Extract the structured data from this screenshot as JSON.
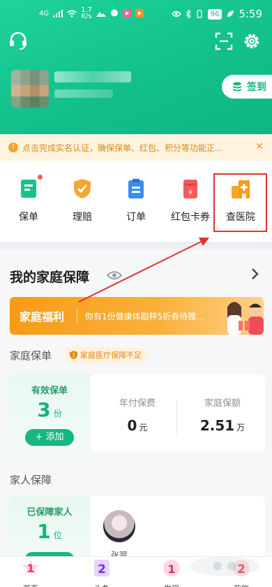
{
  "status_bar": {
    "signal": "4G",
    "speed_value": "1.7",
    "speed_unit": "K/s",
    "battery": "96",
    "time": "5:59"
  },
  "header": {
    "checkin_label": "签到"
  },
  "notice": {
    "text": "点击完成实名认证，确保保单、红包、积分等功能正...",
    "close": "✕"
  },
  "quick_menu": {
    "items": [
      {
        "label": "保单",
        "icon": "policy-icon",
        "color": "#19c18b"
      },
      {
        "label": "理赔",
        "icon": "claim-shield-icon",
        "color": "#f7a531"
      },
      {
        "label": "订单",
        "icon": "order-clipboard-icon",
        "color": "#3a8ef0"
      },
      {
        "label": "红包卡券",
        "icon": "red-packet-icon",
        "color": "#f45a5a"
      },
      {
        "label": "查医院",
        "icon": "hospital-icon",
        "color": "#f7a531"
      }
    ]
  },
  "family": {
    "title": "我的家庭保障",
    "banner_title": "家庭福利",
    "banner_text": "你有1份健康体脂秤5折券待赠...",
    "policy_section_label": "家庭保单",
    "warn_badge": "家庭医疗保障不足",
    "valid_policies_label": "有效保单",
    "valid_policies_count": "3",
    "valid_policies_unit": "份",
    "add_button": "+ 添加",
    "annual_premium_label": "年付保费",
    "annual_premium_value": "0",
    "annual_premium_unit": "元",
    "coverage_label": "家庭保额",
    "coverage_value": "2.51",
    "coverage_unit": "万",
    "member_section_label": "家人保障",
    "covered_members_label": "已保障家人",
    "covered_members_count": "1",
    "covered_members_unit": "位",
    "member_name": "张翠"
  },
  "bottom_nav": {
    "items": [
      {
        "label": "首页",
        "badge": "1"
      },
      {
        "label": "头条",
        "badge": "2"
      },
      {
        "label": "发现",
        "badge": "1"
      },
      {
        "label": "我的",
        "badge": "2"
      }
    ]
  },
  "colors": {
    "brand_green": "#15b783",
    "warning_orange": "#f7a531",
    "highlight_red": "#e53030"
  }
}
